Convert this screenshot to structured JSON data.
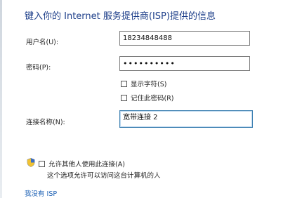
{
  "header": {
    "title": "键入你的 Internet 服务提供商(ISP)提供的信息"
  },
  "form": {
    "username": {
      "label": "用户名(U):",
      "value": "18234848488"
    },
    "password": {
      "label": "密码(P):",
      "masked_value": "••••••••••"
    },
    "show_chars": {
      "label": "显示字符(S)",
      "checked": false
    },
    "remember": {
      "label": "记住此密码(R)",
      "checked": false
    },
    "connection_name": {
      "label": "连接名称(N):",
      "value": "宽带连接 2"
    },
    "allow_others": {
      "label": "允许其他人使用此连接(A)",
      "checked": false,
      "description": "这个选项允许可以访问这台计算机的人"
    }
  },
  "footer": {
    "no_isp_link": "我没有 ISP"
  },
  "colors": {
    "title": "#1e3f8a",
    "link": "#1a5fb4",
    "focus_border": "#3c7fb1"
  },
  "icons": {
    "shield": "uac-shield-icon"
  }
}
